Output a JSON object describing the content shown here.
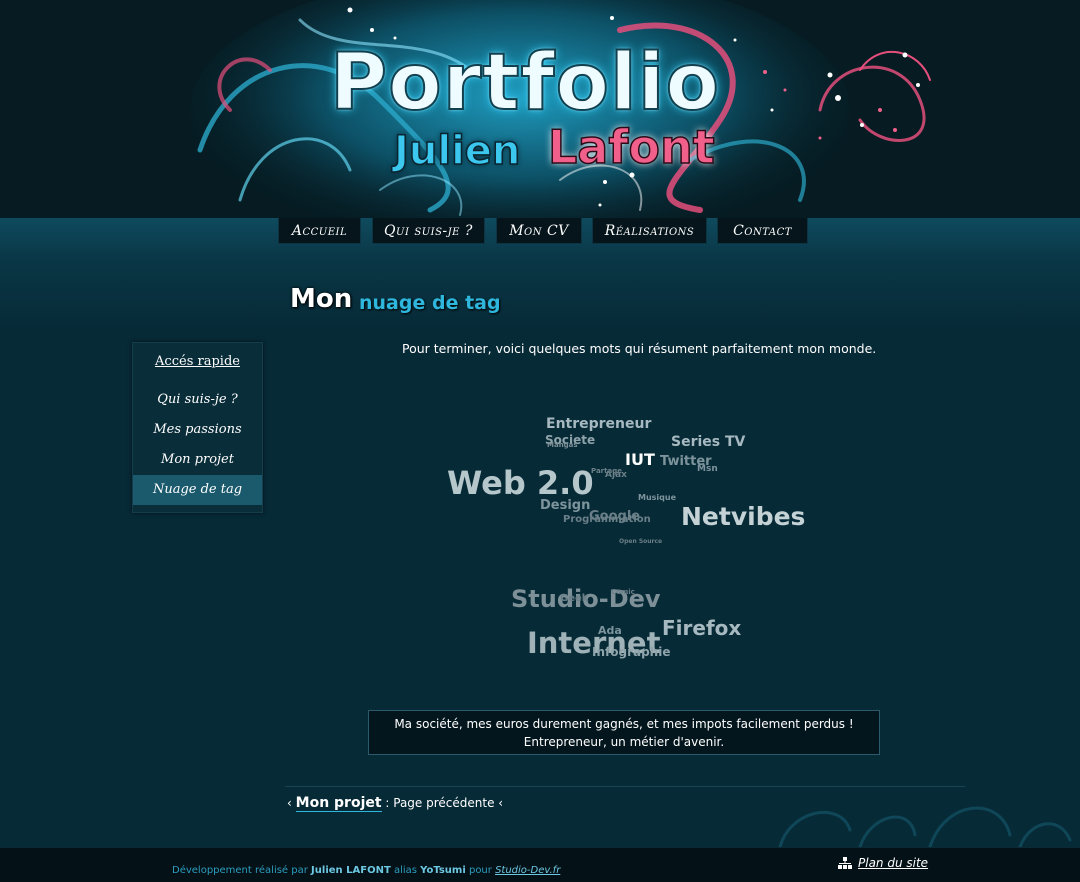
{
  "header": {
    "logo_main": "Portfolio",
    "logo_first": "Julien",
    "logo_last": "Lafont"
  },
  "nav": {
    "items": [
      {
        "label": "Accueil"
      },
      {
        "label": "Qui suis-je ?"
      },
      {
        "label": "Mon CV"
      },
      {
        "label": "Réalisations"
      },
      {
        "label": "Contact"
      }
    ]
  },
  "sidebar": {
    "title": "Accés rapide",
    "links": [
      {
        "label": "Qui suis-je ?"
      },
      {
        "label": "Mes passions"
      },
      {
        "label": "Mon projet"
      },
      {
        "label": "Nuage de tag"
      }
    ],
    "active_index": 3
  },
  "page": {
    "title_main": "Mon",
    "title_sub": "nuage de tag",
    "intro": "Pour terminer, voici quelques mots qui résument parfaitement mon monde."
  },
  "tag_cloud": [
    {
      "text": "Entrepreneur"
    },
    {
      "text": "Societe"
    },
    {
      "text": "Mangas"
    },
    {
      "text": "Series TV"
    },
    {
      "text": "IUT"
    },
    {
      "text": "Twitter"
    },
    {
      "text": "Msn"
    },
    {
      "text": "Partage"
    },
    {
      "text": "Ajax"
    },
    {
      "text": "Web 2.0"
    },
    {
      "text": "Musique"
    },
    {
      "text": "Design"
    },
    {
      "text": "Google"
    },
    {
      "text": "Programmation"
    },
    {
      "text": "Netvibes"
    },
    {
      "text": "Open Source"
    },
    {
      "text": "Studio-Dev"
    },
    {
      "text": "Geek"
    },
    {
      "text": "Comic"
    },
    {
      "text": "Firefox"
    },
    {
      "text": "Ada"
    },
    {
      "text": "Internet"
    },
    {
      "text": "Infographie"
    }
  ],
  "quote": {
    "line1": "Ma société, mes euros durement gagnés, et mes impots facilement perdus !",
    "line2": "Entrepreneur, un métier d'avenir."
  },
  "pagination": {
    "prev_link": "Mon projet",
    "prev_text": ": Page précédente",
    "arrow": "‹"
  },
  "footer": {
    "credit_prefix": "Développement réalisé par",
    "author": "Julien LAFONT",
    "alias_word": "alias",
    "alias": "YoTsumi",
    "for_word": "pour",
    "site": "Studio-Dev.fr",
    "sitemap": "Plan du site"
  },
  "colors": {
    "background": "#072a37",
    "accent_cyan": "#2fb6dc",
    "accent_pink": "#f0608a"
  }
}
